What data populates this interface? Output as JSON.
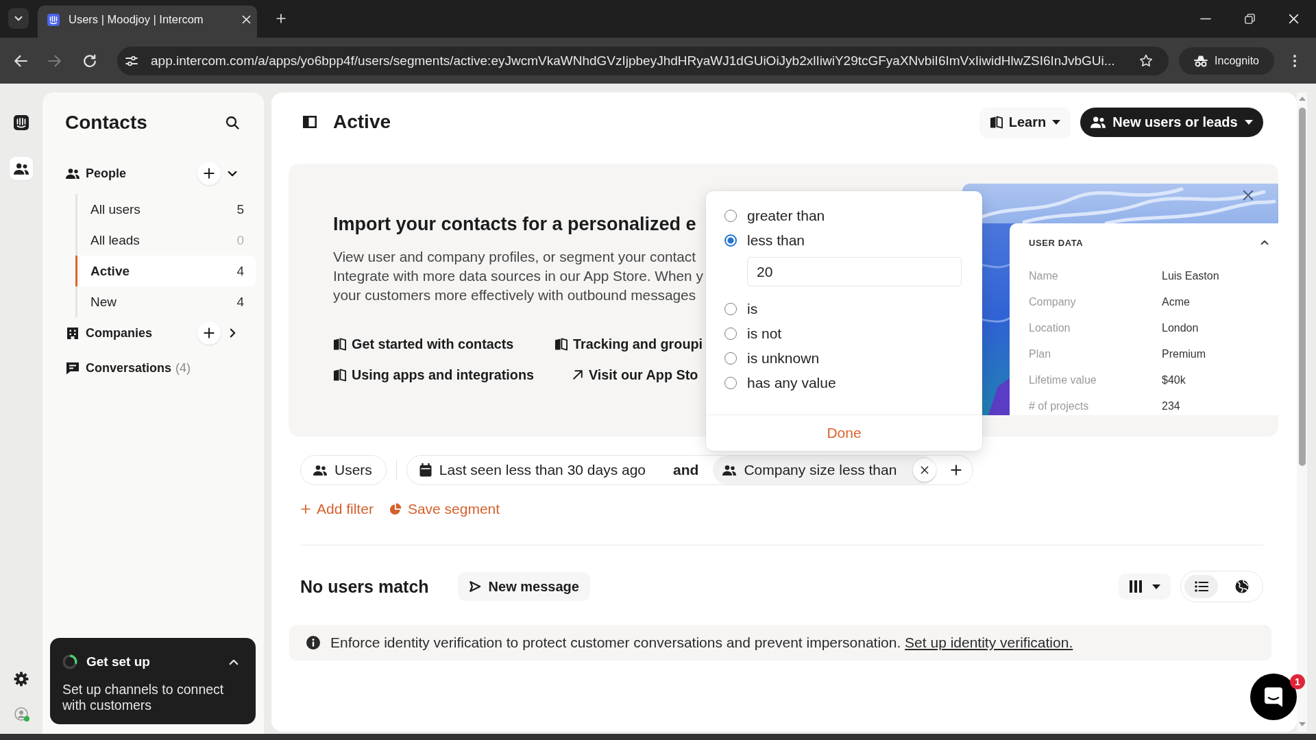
{
  "browser": {
    "tab": {
      "title": "Users | Moodjoy | Intercom"
    },
    "forward_disabled": true,
    "url": "app.intercom.com/a/apps/yo6bpp4f/users/segments/active:eyJwcmVkaWNhdGVzIjpbeyJhdHRyaWJ1dGUiOiJyb2xlIiwiY29tcGFyaXNvbiI6ImVxIiwidHlwZSI6InJvbGUi...",
    "profile": "Incognito"
  },
  "rail": {
    "items": [
      {
        "selected": false
      },
      {
        "selected": true
      }
    ]
  },
  "contacts": {
    "title": "Contacts",
    "sections": [
      {
        "kind": "group",
        "label": "People",
        "expanded": true,
        "items": [
          {
            "label": "All users",
            "count": "5",
            "selected": false,
            "dimmed": false
          },
          {
            "label": "All leads",
            "count": "0",
            "selected": false,
            "dimmed": true
          },
          {
            "label": "Active",
            "count": "4",
            "selected": true,
            "dimmed": false
          },
          {
            "label": "New",
            "count": "4",
            "selected": false,
            "dimmed": false
          }
        ]
      },
      {
        "kind": "group",
        "label": "Companies",
        "expanded": false
      },
      {
        "kind": "link",
        "label": "Conversations",
        "count": "(4)"
      }
    ],
    "setup": {
      "title": "Get set up",
      "text": "Set up channels to connect with customers"
    }
  },
  "main": {
    "title": "Active",
    "learn": "Learn",
    "create": "New users or leads",
    "banner": {
      "heading": "Import your contacts for a personalized e",
      "lines": [
        "View user and company profiles, or segment your contact",
        "Integrate with more data sources in our App Store. When y",
        "your customers more effectively with outbound messages"
      ],
      "links": [
        {
          "kind": "guide",
          "label": "Get started with contacts"
        },
        {
          "kind": "guide",
          "label": "Tracking and groupi"
        },
        {
          "kind": "guide",
          "label": "Using apps and integrations"
        },
        {
          "kind": "external",
          "label": "Visit our App Sto"
        }
      ],
      "user_data": {
        "title": "USER DATA",
        "rows": [
          {
            "label": "Name",
            "value": "Luis Easton"
          },
          {
            "label": "Company",
            "value": "Acme"
          },
          {
            "label": "Location",
            "value": "London"
          },
          {
            "label": "Plan",
            "value": "Premium"
          },
          {
            "label": "Lifetime value",
            "value": "$40k"
          },
          {
            "label": "# of projects",
            "value": "234"
          }
        ]
      }
    },
    "popup": {
      "options": [
        {
          "label": "greater than",
          "selected": false
        },
        {
          "label": "less than",
          "selected": true,
          "value": "20"
        },
        {
          "label": "is",
          "selected": false
        },
        {
          "label": "is not",
          "selected": false
        },
        {
          "label": "is unknown",
          "selected": false
        },
        {
          "label": "has any value",
          "selected": false
        }
      ],
      "done": "Done"
    },
    "filters": {
      "audience": "Users",
      "joiner": "and",
      "conditions": [
        {
          "kind": "date",
          "label": "Last seen less than 30 days ago",
          "selected": false
        },
        {
          "kind": "company",
          "label": "Company size less than",
          "selected": true
        }
      ],
      "add_filter": "Add filter",
      "save_segment": "Save segment"
    },
    "results": {
      "title": "No users match",
      "message_button": "New message",
      "view_modes": [
        {
          "selected": true
        },
        {
          "selected": false
        }
      ]
    },
    "notice": {
      "text": "Enforce identity verification to protect customer conversations and prevent impersonation.",
      "link": "Set up identity verification."
    },
    "messenger": {
      "badge": "1"
    }
  }
}
